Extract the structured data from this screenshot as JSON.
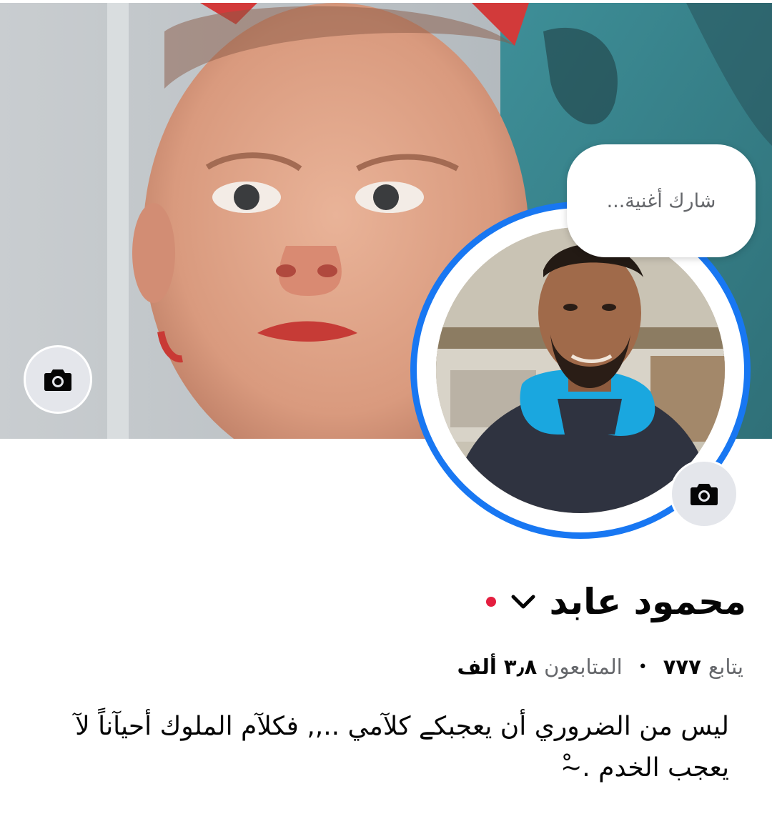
{
  "profile": {
    "name": "محمود عابد",
    "note_placeholder": "شارك أغنية...",
    "followers_count": "٣٫٨ ألف",
    "followers_label": "المتابعون",
    "following_count": "٧٧٧",
    "following_label": "يتابع",
    "separator": "•",
    "bio": "ليس من الضروري أن يعجبكے كلآمي ..,, فكلآم الملوك أحيآناً لآ يعجب الخدم .~ْ"
  },
  "colors": {
    "accent": "#1877f2",
    "status_dot": "#e41e3f",
    "icon_bg": "#e4e6eb",
    "secondary_text": "#65676b",
    "primary_text": "#050505"
  },
  "icons": {
    "cover_camera": "camera-icon",
    "avatar_camera": "camera-icon",
    "name_dropdown": "chevron-down-icon"
  }
}
